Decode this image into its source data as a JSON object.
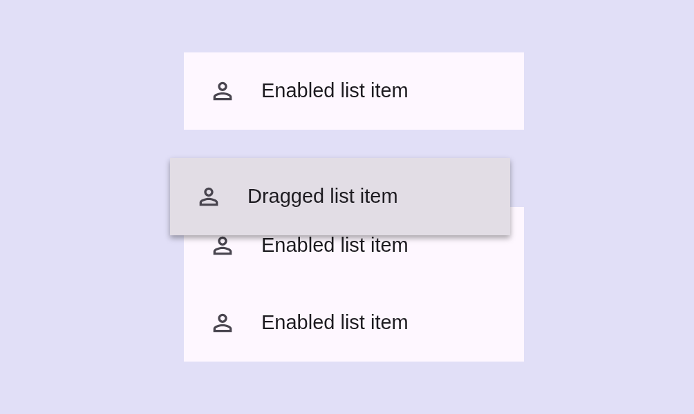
{
  "cards": [
    {
      "items": [
        {
          "label": "Enabled list item"
        }
      ]
    },
    {
      "items": [
        {
          "label": "Enabled list item"
        },
        {
          "label": "Enabled list item"
        }
      ]
    }
  ],
  "dragged_item": {
    "label": "Dragged list item"
  }
}
